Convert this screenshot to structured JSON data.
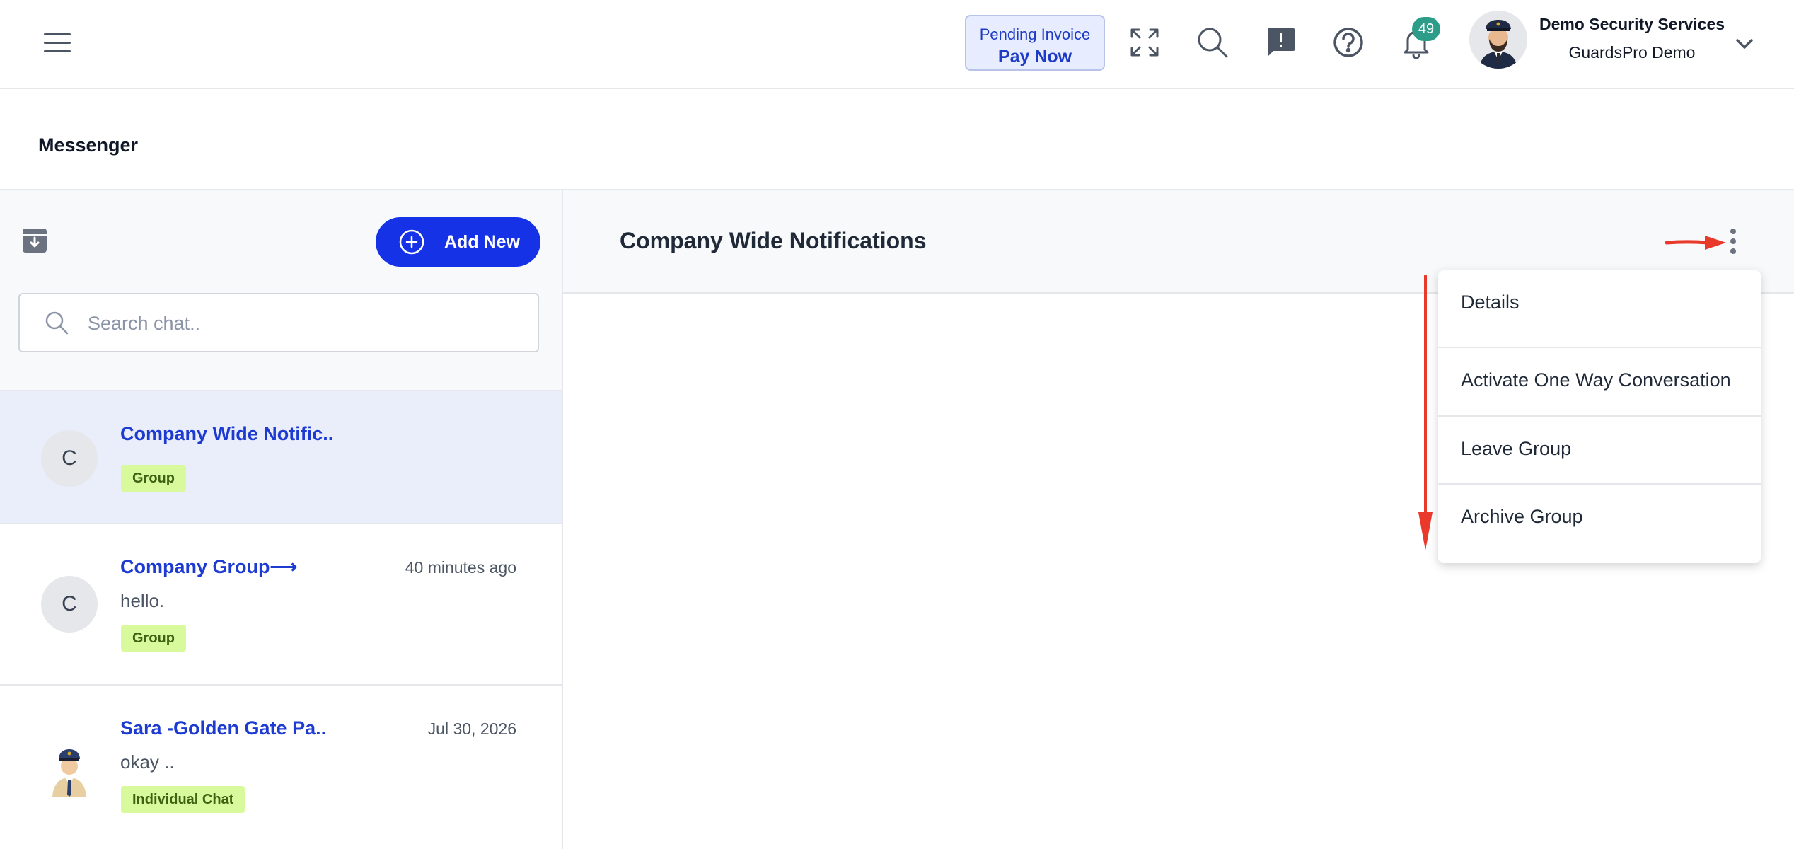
{
  "topbar": {
    "pending_invoice": {
      "line1": "Pending Invoice",
      "line2": "Pay Now"
    },
    "notifications_count": "49",
    "user": {
      "name": "Demo Security Services",
      "org": "GuardsPro Demo"
    },
    "icons": [
      "menu-icon",
      "expand-icon",
      "search-icon",
      "feedback-icon",
      "help-icon",
      "bell-icon",
      "chevron-down-icon"
    ]
  },
  "page": {
    "title": "Messenger"
  },
  "sidebar": {
    "add_new_label": "Add New",
    "search_placeholder": "Search chat..",
    "chats": [
      {
        "initial": "C",
        "name": "Company Wide Notific..",
        "time": "",
        "message": "",
        "tag": "Group",
        "active": true
      },
      {
        "initial": "C",
        "name": "Company Group⟶",
        "time": "40 minutes ago",
        "message": "hello.",
        "tag": "Group",
        "active": false
      },
      {
        "initial": "",
        "name": "Sara -Golden Gate Pa..",
        "time": "Jul 30, 2026",
        "message": "okay ..",
        "tag": "Individual Chat",
        "active": false
      }
    ]
  },
  "conversation": {
    "title": "Company Wide Notifications",
    "menu": {
      "items": [
        "Details",
        "Activate One Way Conversation",
        "Leave Group",
        "Archive Group"
      ]
    }
  },
  "colors": {
    "primary": "#1532e6",
    "link": "#1d3bd1",
    "badge": "#2d9d8a",
    "tag_bg": "#d9f99d",
    "annotation_arrow": "#e8392b"
  }
}
